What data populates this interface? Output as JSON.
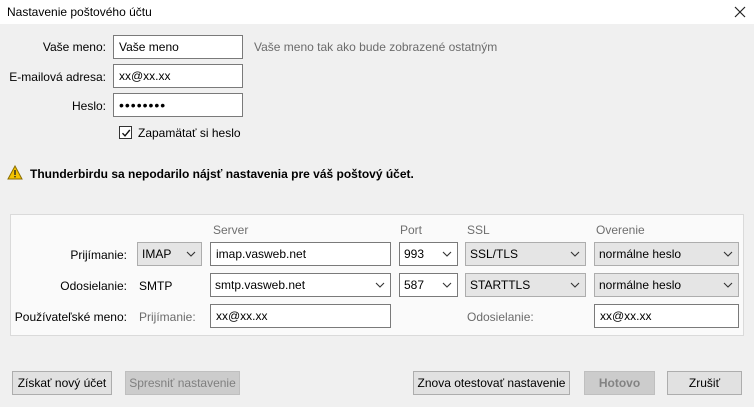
{
  "window": {
    "title": "Nastavenie poštového účtu",
    "close_glyph": "✕"
  },
  "form": {
    "name_label": "Vaše meno:",
    "name_value": "Vaše meno",
    "name_hint": "Vaše meno tak ako bude zobrazené ostatným",
    "email_label": "E-mailová adresa:",
    "email_value": "xx@xx.xx",
    "password_label": "Heslo:",
    "password_value": "••••••••",
    "remember_label": "Zapamätať si heslo",
    "remember_checked": true
  },
  "warning": {
    "icon": "warning-icon",
    "text": "Thunderbirdu sa nepodarilo nájsť nastavenia pre váš poštový účet."
  },
  "settings": {
    "headers": {
      "server": "Server",
      "port": "Port",
      "ssl": "SSL",
      "auth": "Overenie"
    },
    "incoming": {
      "label": "Prijímanie:",
      "protocol": "IMAP",
      "server": "imap.vasweb.net",
      "port": "993",
      "ssl": "SSL/TLS",
      "auth": "normálne heslo"
    },
    "outgoing": {
      "label": "Odosielanie:",
      "protocol": "SMTP",
      "server": "smtp.vasweb.net",
      "port": "587",
      "ssl": "STARTTLS",
      "auth": "normálne heslo"
    },
    "username": {
      "label": "Používateľské meno:",
      "incoming_label": "Prijímanie:",
      "incoming_value": "xx@xx.xx",
      "outgoing_label": "Odosielanie:",
      "outgoing_value": "xx@xx.xx"
    }
  },
  "buttons": {
    "new_account": "Získať nový účet",
    "advanced": "Spresniť nastavenie",
    "retest": "Znova otestovať nastavenie",
    "done": "Hotovo",
    "cancel": "Zrušiť"
  },
  "colors": {
    "warning": "#f2c200",
    "disabled_bg": "#cccccc"
  }
}
